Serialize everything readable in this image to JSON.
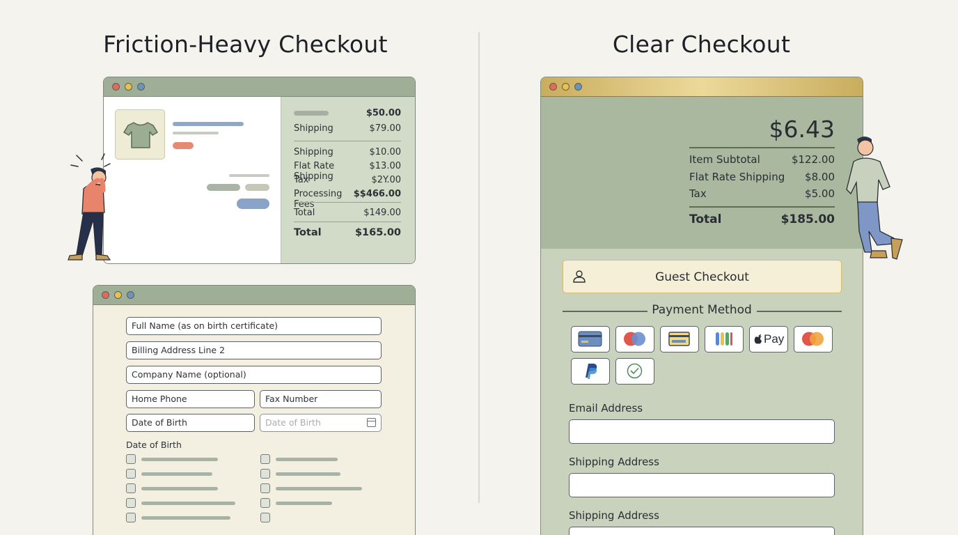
{
  "headings": {
    "left": "Friction-Heavy Checkout",
    "right": "Clear Checkout"
  },
  "friction_cart": {
    "summary_top": [
      {
        "label": "",
        "amount": "$50.00",
        "bold": true
      },
      {
        "label": "Shipping",
        "amount": "$79.00"
      }
    ],
    "summary_mid": [
      {
        "label": "Shipping",
        "amount": "$10.00"
      },
      {
        "label": "Flat Rate Shipping",
        "amount": "$13.00"
      },
      {
        "label": "Tax",
        "amount": "$2Y.00"
      },
      {
        "label": "Processing Fees",
        "amount": "$$466.00"
      }
    ],
    "subtotal": {
      "label": "Total",
      "amount": "$149.00"
    },
    "total": {
      "label": "Total",
      "amount": "$165.00"
    }
  },
  "friction_form": {
    "full_name": "Full Name (as on birth certificate)",
    "billing_line2": "Billing Address Line 2",
    "company": "Company Name (optional)",
    "home_phone": "Home Phone",
    "fax": "Fax Number",
    "dob": "Date of Birth",
    "dob_placeholder": "Date of Birth",
    "dob_section_label": "Date of Birth"
  },
  "clear_checkout": {
    "big_total": "$6.43",
    "rows": [
      {
        "label": "Item Subtotal",
        "amount": "$122.00"
      },
      {
        "label": "Flat Rate Shipping",
        "amount": "$8.00"
      },
      {
        "label": "Tax",
        "amount": "$5.00"
      }
    ],
    "total": {
      "label": "Total",
      "amount": "$185.00"
    },
    "guest_label": "Guest Checkout",
    "payment_title": "Payment Method",
    "payment_methods": [
      "card-icon",
      "mastercard-icon",
      "wallet-card-icon",
      "google-pay-icon",
      "apple-pay-icon",
      "mastercard-icon",
      "paypal-icon",
      "check-icon"
    ],
    "apple_pay_text": "Pay",
    "email_label": "Email Address",
    "shipping_label_1": "Shipping Address",
    "shipping_label_2": "Shipping Address"
  },
  "colors": {
    "sage": "#a9b89f",
    "cream": "#f4efd6",
    "gold": "#d3bc6a"
  }
}
